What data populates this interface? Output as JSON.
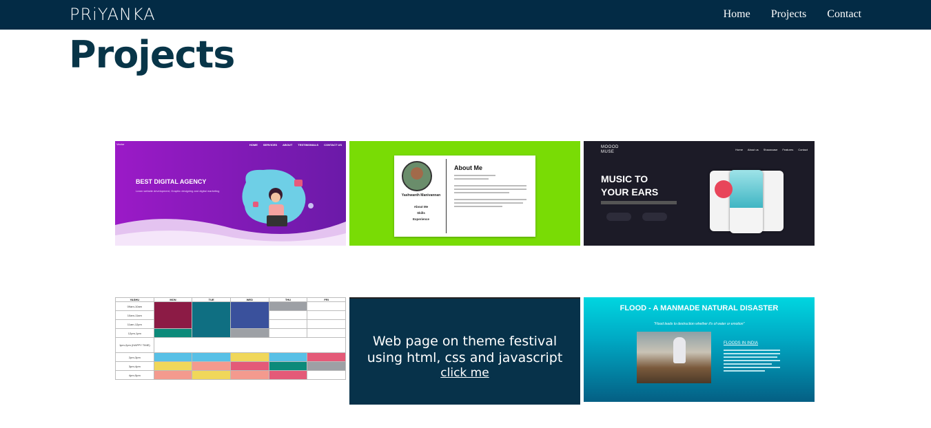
{
  "brand": "PRiYANKA",
  "nav": {
    "home": "Home",
    "projects": "Projects",
    "contact": "Contact"
  },
  "page_title": "Projects",
  "card1": {
    "nav_items": [
      "HOME",
      "SERVICES",
      "ABOUT",
      "TESTIMONIALS",
      "CONTACT US"
    ],
    "headline": "BEST DIGITAL AGENCY",
    "subtext": "Learn website development, Graphic designing and digital marketing"
  },
  "card2": {
    "name": "Yashwanth Manivannan",
    "menu": [
      "About Me",
      "Skills",
      "Experience"
    ],
    "about_heading": "About Me"
  },
  "card3": {
    "logo_line1": "MOOOD",
    "logo_line2": "MUSE",
    "nav_items": [
      "Home",
      "About us",
      "Shaowcase",
      "Features",
      "Contact"
    ],
    "headline_1": "MUSIC TO",
    "headline_2": "YOUR EARS"
  },
  "card4": {
    "headers": [
      "YASHU",
      "MON",
      "TUE",
      "WED",
      "THU",
      "FRI"
    ],
    "times": [
      "09am-10am",
      "10am-11am",
      "11am-12pm",
      "12pm-1pm",
      "1pm-2pm (HAPPY TIME)",
      "2pm-3pm",
      "3pm-4pm",
      "4pm-5pm"
    ]
  },
  "card5": {
    "line1": "Web page on theme festival",
    "line2": "using html, css and javascript",
    "link": "click me"
  },
  "card6": {
    "title": "FLOOD - A MANMADE NATURAL DISASTER",
    "quote": "\"Flood leads to destruction whether it's of water or emotion\"",
    "subheading": "FLOODS IN INDIA"
  },
  "colors": {
    "navbar": "#032b45",
    "title": "#083548",
    "card2_bg": "#79dc05",
    "card5_bg": "#07324a"
  }
}
